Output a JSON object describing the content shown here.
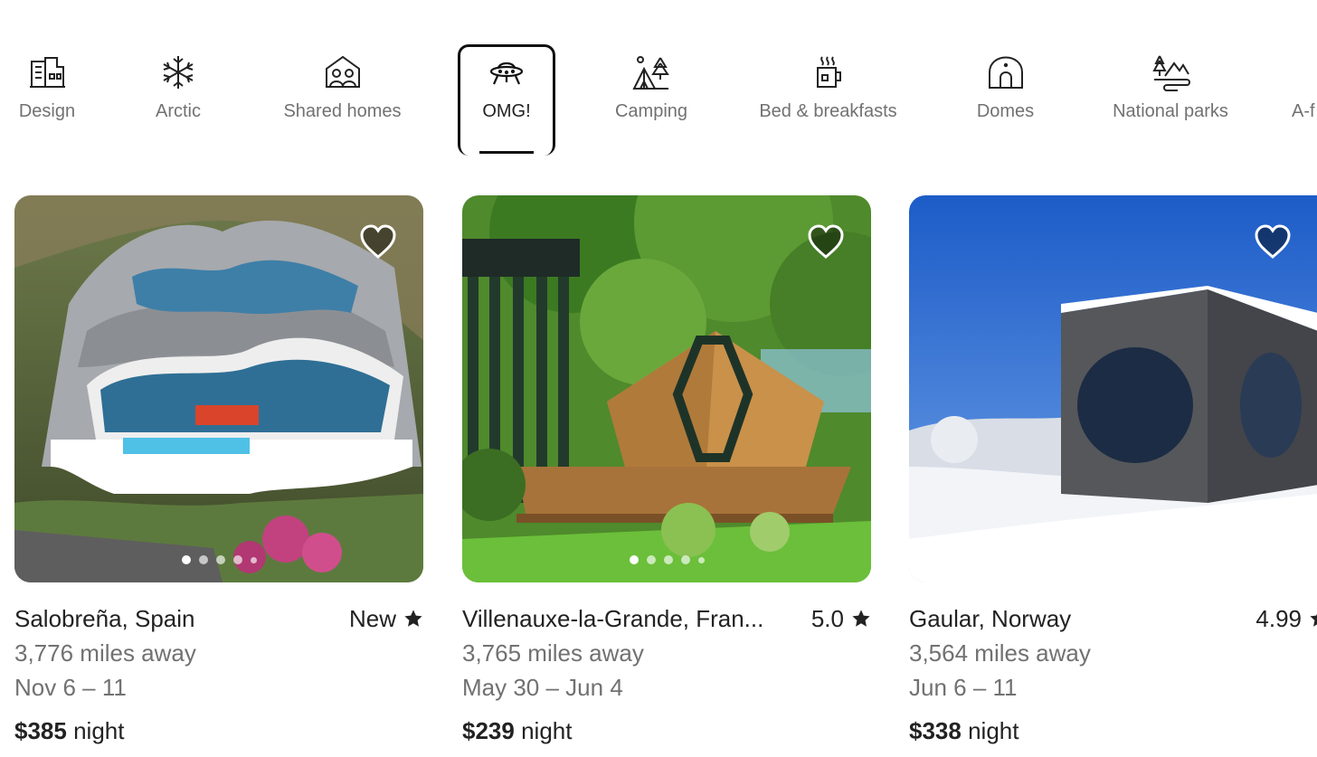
{
  "categories": [
    {
      "label": "Design",
      "icon": "design-icon"
    },
    {
      "label": "Arctic",
      "icon": "snowflake-icon"
    },
    {
      "label": "Shared homes",
      "icon": "shared-homes-icon"
    },
    {
      "label": "OMG!",
      "icon": "ufo-icon",
      "selected": true
    },
    {
      "label": "Camping",
      "icon": "camping-icon"
    },
    {
      "label": "Bed & breakfasts",
      "icon": "mug-icon"
    },
    {
      "label": "Domes",
      "icon": "dome-icon"
    },
    {
      "label": "National parks",
      "icon": "national-parks-icon"
    },
    {
      "label": "A-f",
      "icon": "a-frame-icon"
    }
  ],
  "listings": [
    {
      "location": "Salobreña, Spain",
      "rating": "New",
      "distance": "3,776 miles away",
      "dates": "Nov 6 – 11",
      "price": "$385",
      "price_unit": "night",
      "photo_dots": 5,
      "favorited": false
    },
    {
      "location": "Villenauxe-la-Grande, Fran...",
      "rating": "5.0",
      "distance": "3,765 miles away",
      "dates": "May 30 – Jun 4",
      "price": "$239",
      "price_unit": "night",
      "photo_dots": 5,
      "favorited": false
    },
    {
      "location": "Gaular, Norway",
      "rating": "4.99",
      "distance": "3,564 miles away",
      "dates": "Jun 6 – 11",
      "price": "$338",
      "price_unit": "night",
      "photo_dots": 5,
      "favorited": false
    }
  ],
  "colors": {
    "text_primary": "#222222",
    "text_secondary": "#717171",
    "selected_border": "#111111"
  }
}
